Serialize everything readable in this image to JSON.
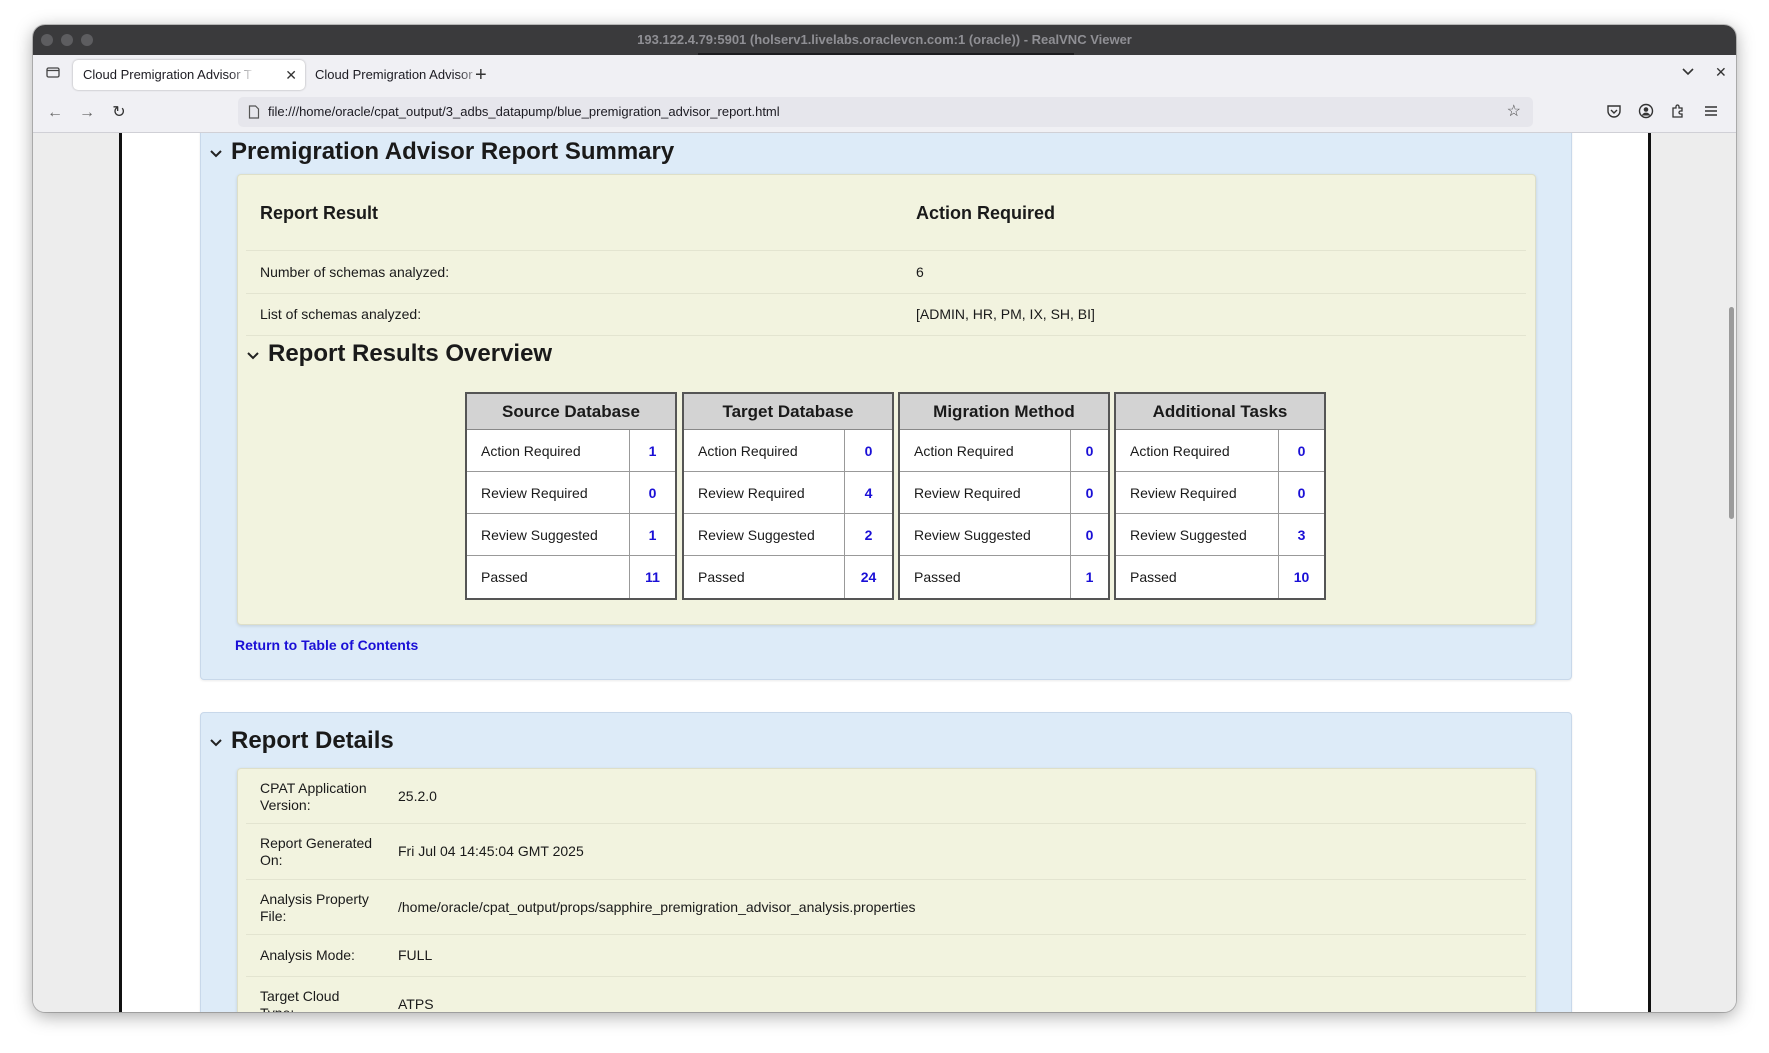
{
  "window": {
    "title": "193.122.4.79:5901 (holserv1.livelabs.oraclevcn.com:1 (oracle)) - RealVNC Viewer"
  },
  "browser": {
    "tabs": [
      {
        "label": "Cloud Premigration Advisor T",
        "active": true
      },
      {
        "label": "Cloud Premigration Advisor T",
        "active": false
      }
    ],
    "url": "file:///home/oracle/cpat_output/3_adbs_datapump/blue_premigration_advisor_report.html"
  },
  "summary": {
    "title": "Premigration Advisor Report Summary",
    "result_label": "Report Result",
    "result_value": "Action Required",
    "schemas_count_label": "Number of schemas analyzed:",
    "schemas_count_value": "6",
    "schemas_list_label": "List of schemas analyzed:",
    "schemas_list_value": "[ADMIN, HR, PM, IX, SH, BI]",
    "return_link": "Return to Table of Contents"
  },
  "overview": {
    "title": "Report Results Overview",
    "tables": [
      {
        "name": "Source Database",
        "rows": [
          {
            "label": "Action Required",
            "count": "1"
          },
          {
            "label": "Review Required",
            "count": "0"
          },
          {
            "label": "Review Suggested",
            "count": "1"
          },
          {
            "label": "Passed",
            "count": "11"
          }
        ]
      },
      {
        "name": "Target Database",
        "rows": [
          {
            "label": "Action Required",
            "count": "0"
          },
          {
            "label": "Review Required",
            "count": "4"
          },
          {
            "label": "Review Suggested",
            "count": "2"
          },
          {
            "label": "Passed",
            "count": "24"
          }
        ]
      },
      {
        "name": "Migration Method",
        "rows": [
          {
            "label": "Action Required",
            "count": "0"
          },
          {
            "label": "Review Required",
            "count": "0"
          },
          {
            "label": "Review Suggested",
            "count": "0"
          },
          {
            "label": "Passed",
            "count": "1"
          }
        ]
      },
      {
        "name": "Additional Tasks",
        "rows": [
          {
            "label": "Action Required",
            "count": "0"
          },
          {
            "label": "Review Required",
            "count": "0"
          },
          {
            "label": "Review Suggested",
            "count": "3"
          },
          {
            "label": "Passed",
            "count": "10"
          }
        ]
      }
    ]
  },
  "details": {
    "title": "Report Details",
    "rows": [
      {
        "label": "CPAT Application Version:",
        "value": "25.2.0"
      },
      {
        "label": "Report Generated On:",
        "value": "Fri Jul 04 14:45:04 GMT 2025"
      },
      {
        "label": "Analysis Property File:",
        "value": "/home/oracle/cpat_output/props/sapphire_premigration_advisor_analysis.properties"
      },
      {
        "label": "Analysis Mode:",
        "value": "FULL"
      },
      {
        "label": "Target Cloud Type:",
        "value": "ATPS"
      }
    ]
  },
  "colors": {
    "section_bg": "#ddebf8",
    "inner_bg": "#f2f3df",
    "link": "#1a0fd6",
    "table_header_bg": "#d3d3d3"
  },
  "icons": {
    "tab_list": "tab-list-icon",
    "close": "close-icon",
    "new_tab": "plus-icon",
    "back": "back-arrow-icon",
    "forward": "forward-arrow-icon",
    "reload": "reload-icon",
    "page": "page-icon",
    "bookmark": "star-icon",
    "pocket": "pocket-icon",
    "account": "account-icon",
    "extensions": "extensions-icon",
    "menu": "hamburger-menu-icon",
    "collapse": "chevron-down-icon"
  }
}
